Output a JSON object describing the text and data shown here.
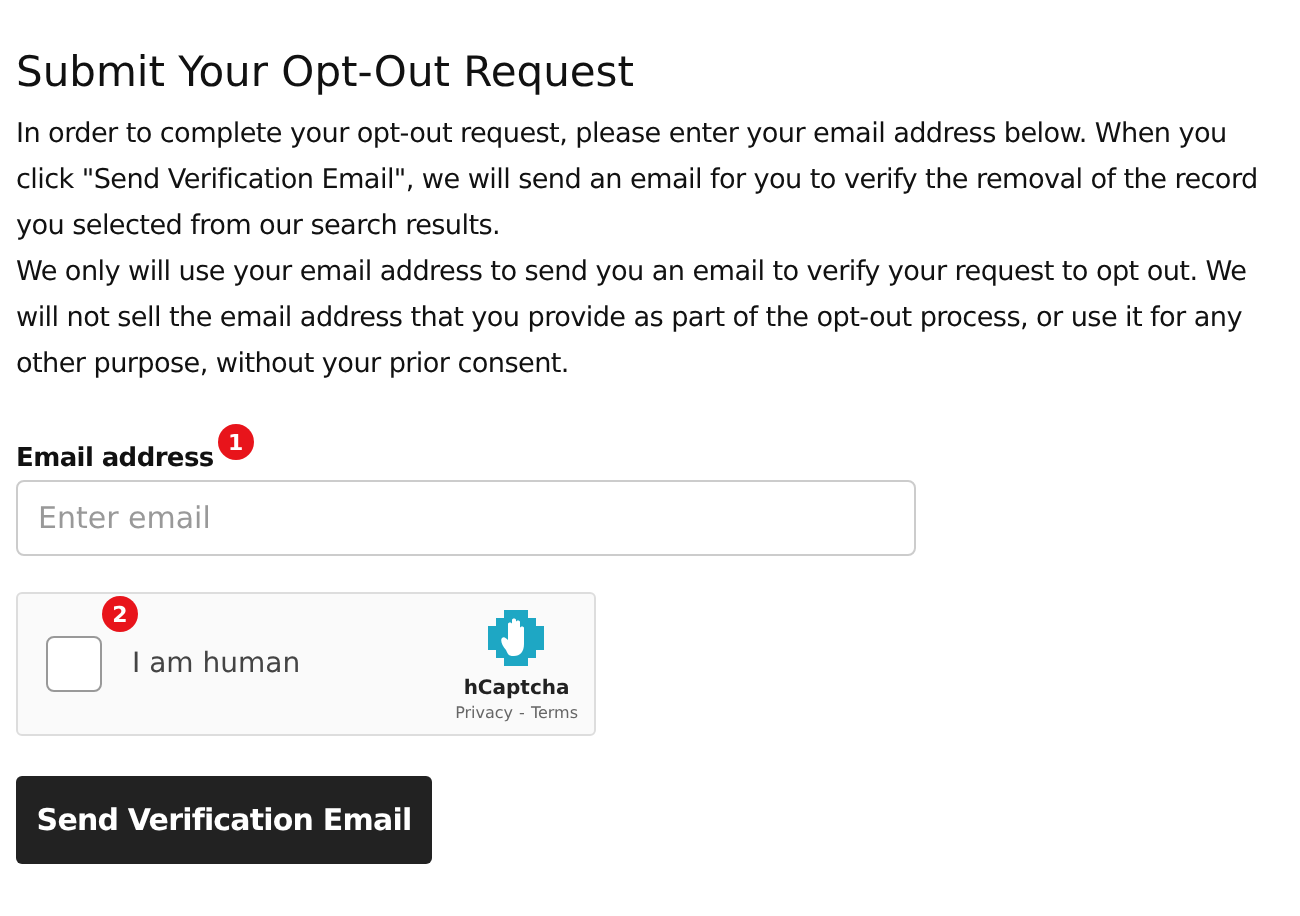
{
  "title": "Submit Your Opt-Out Request",
  "paragraphs": [
    "In order to complete your opt-out request, please enter your email address below. When you click \"Send Verification Email\", we will send an email for you to verify the removal of the record you selected from our search results.",
    "We only will use your email address to send you an email to verify your request to opt out. We will not sell the email address that you provide as part of the opt-out process, or use it for any other purpose, without your prior consent."
  ],
  "email": {
    "label": "Email address",
    "badge": "1",
    "placeholder": "Enter email"
  },
  "captcha": {
    "badge": "2",
    "checked": false,
    "label": "I am human",
    "brand": "hCaptcha",
    "privacy": "Privacy",
    "separator": "-",
    "terms": "Terms"
  },
  "submit": "Send Verification Email"
}
